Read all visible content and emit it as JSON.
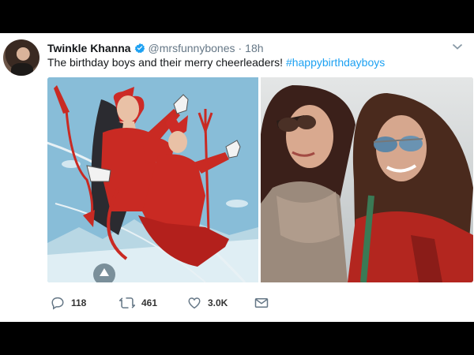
{
  "tweet": {
    "display_name": "Twinkle Khanna",
    "handle": "@mrsfunnybones",
    "separator": "·",
    "time": "18h",
    "text": "The birthday boys and their merry cheerleaders!",
    "hashtag": "#happybirthdayboys",
    "accent": "#1da1f2"
  },
  "actions": {
    "reply_count": "118",
    "retweet_count": "461",
    "like_count": "3.0K"
  },
  "icons": [
    "verified-badge-icon",
    "chevron-down-icon",
    "reply-icon",
    "retweet-icon",
    "heart-icon",
    "envelope-icon"
  ]
}
